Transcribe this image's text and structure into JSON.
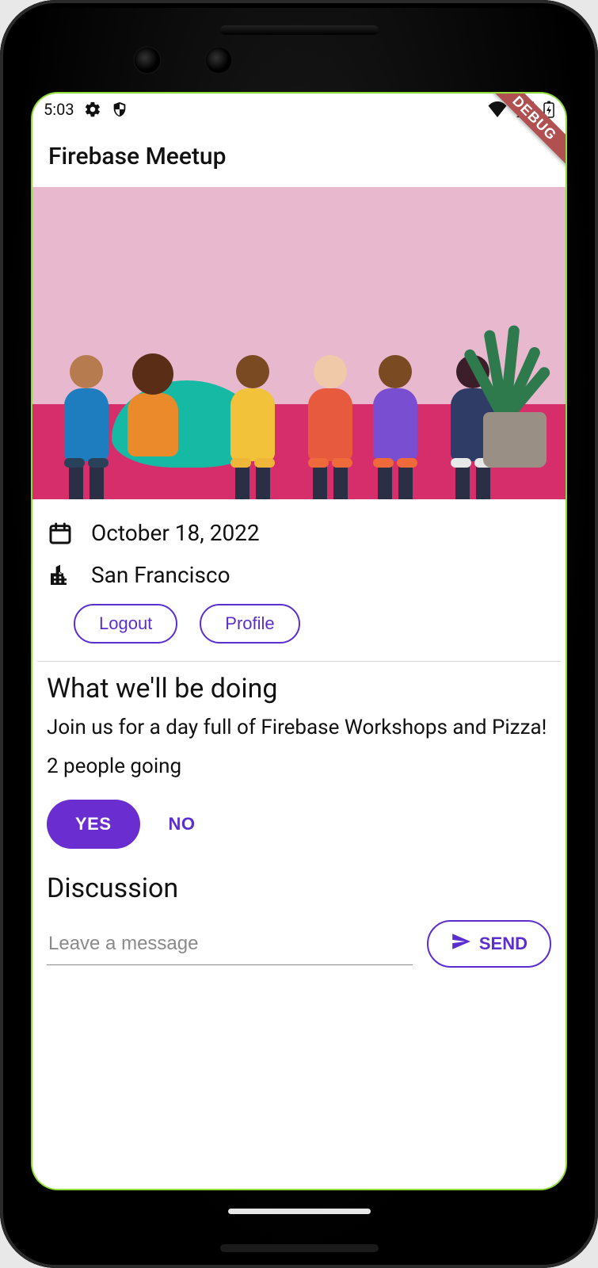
{
  "status": {
    "time": "5:03"
  },
  "debug_ribbon": "DEBUG",
  "appbar": {
    "title": "Firebase Meetup"
  },
  "event": {
    "date": "October 18, 2022",
    "location": "San Francisco"
  },
  "auth": {
    "logout_label": "Logout",
    "profile_label": "Profile"
  },
  "about": {
    "heading": "What we'll be doing",
    "description": "Join us for a day full of Firebase Workshops and Pizza!",
    "attending_text": "2 people going"
  },
  "rsvp": {
    "yes_label": "YES",
    "no_label": "NO"
  },
  "discussion": {
    "heading": "Discussion",
    "input_placeholder": "Leave a message",
    "send_label": "SEND"
  },
  "colors": {
    "accent": "#5b2ed0"
  }
}
